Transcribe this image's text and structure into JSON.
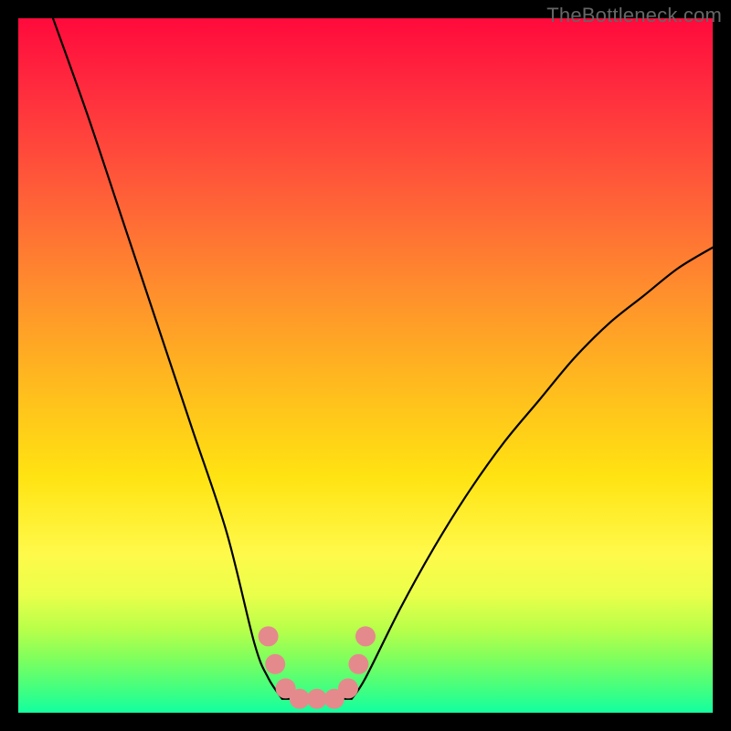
{
  "watermark": "TheBottleneck.com",
  "chart_data": {
    "type": "line",
    "title": "",
    "xlabel": "",
    "ylabel": "",
    "xlim": [
      0,
      100
    ],
    "ylim": [
      0,
      100
    ],
    "series": [
      {
        "name": "curve-left",
        "x": [
          5,
          10,
          15,
          20,
          25,
          30,
          34,
          36,
          38
        ],
        "values": [
          100,
          86,
          71,
          56,
          41,
          26,
          10,
          5,
          2
        ]
      },
      {
        "name": "curve-right",
        "x": [
          48,
          50,
          55,
          60,
          65,
          70,
          75,
          80,
          85,
          90,
          95,
          100
        ],
        "values": [
          2,
          5,
          15,
          24,
          32,
          39,
          45,
          51,
          56,
          60,
          64,
          67
        ]
      },
      {
        "name": "flat-floor",
        "x": [
          38,
          48
        ],
        "values": [
          2,
          2
        ]
      }
    ],
    "markers": {
      "name": "reference-points",
      "color": "#e58a8c",
      "points_xy": [
        [
          36.0,
          11.0
        ],
        [
          37.0,
          7.0
        ],
        [
          38.5,
          3.5
        ],
        [
          40.5,
          2.0
        ],
        [
          43.0,
          2.0
        ],
        [
          45.5,
          2.0
        ],
        [
          47.5,
          3.5
        ],
        [
          49.0,
          7.0
        ],
        [
          50.0,
          11.0
        ]
      ]
    },
    "gradient_stops": [
      {
        "pos": 0.0,
        "color": "#ff0a3c"
      },
      {
        "pos": 0.1,
        "color": "#ff2b3e"
      },
      {
        "pos": 0.24,
        "color": "#ff5a39"
      },
      {
        "pos": 0.38,
        "color": "#ff8a2e"
      },
      {
        "pos": 0.52,
        "color": "#ffb81f"
      },
      {
        "pos": 0.66,
        "color": "#ffe312"
      },
      {
        "pos": 0.77,
        "color": "#fff94a"
      },
      {
        "pos": 0.83,
        "color": "#eaff4a"
      },
      {
        "pos": 0.88,
        "color": "#b8ff4a"
      },
      {
        "pos": 0.92,
        "color": "#82ff5c"
      },
      {
        "pos": 0.96,
        "color": "#4aff7a"
      },
      {
        "pos": 1.0,
        "color": "#13ffa0"
      }
    ]
  }
}
